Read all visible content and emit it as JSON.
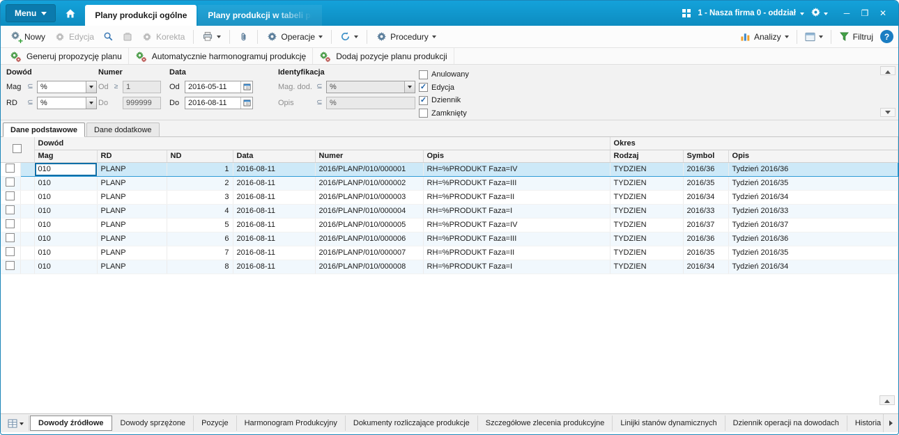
{
  "titlebar": {
    "menu_label": "Menu",
    "company_label": "1 - Nasza firma 0 - oddział",
    "tabs": [
      {
        "label": "Plany produkcji ogólne",
        "active": true
      },
      {
        "label": "Plany produkcji w tabeli prze",
        "active": false
      }
    ]
  },
  "icons": {
    "minimize": "─",
    "maximize": "❐",
    "close": "✕",
    "help": "?"
  },
  "toolbar": {
    "nowy": "Nowy",
    "edycja": "Edycja",
    "korekta": "Korekta",
    "operacje": "Operacje",
    "procedury": "Procedury",
    "analizy": "Analizy",
    "filtruj": "Filtruj"
  },
  "actions": [
    "Generuj propozycję planu",
    "Automatycznie harmonogramuj produkcję",
    "Dodaj pozycje planu produkcji"
  ],
  "filters": {
    "sections": {
      "dowod": "Dowód",
      "numer": "Numer",
      "data": "Data",
      "identyfikacja": "Identyfikacja"
    },
    "mag": {
      "label": "Mag",
      "op": "⊆",
      "value": "%"
    },
    "rd": {
      "label": "RD",
      "op": "⊆",
      "value": "%"
    },
    "numer_od": {
      "label": "Od",
      "op": "≥",
      "value": "1"
    },
    "numer_do": {
      "label": "Do",
      "value": "999999"
    },
    "data_od": {
      "label": "Od",
      "value": "2016-05-11"
    },
    "data_do": {
      "label": "Do",
      "value": "2016-08-11"
    },
    "mag_dod": {
      "label": "Mag. dod.",
      "op": "⊆",
      "value": "%"
    },
    "opis": {
      "label": "Opis",
      "op": "⊆",
      "value": "%"
    },
    "checkboxes": [
      {
        "label": "Anulowany",
        "checked": false
      },
      {
        "label": "Edycja",
        "checked": true
      },
      {
        "label": "Dziennik",
        "checked": true
      },
      {
        "label": "Zamknięty",
        "checked": false
      }
    ]
  },
  "data_tabs": [
    {
      "label": "Dane podstawowe",
      "active": true
    },
    {
      "label": "Dane dodatkowe",
      "active": false
    }
  ],
  "table": {
    "groups": {
      "dowod": "Dowód",
      "okres": "Okres"
    },
    "columns": [
      "Mag",
      "RD",
      "ND",
      "Data",
      "Numer",
      "Opis",
      "Rodzaj",
      "Symbol",
      "Opis"
    ],
    "selected_row": 0,
    "rows": [
      [
        "010",
        "PLANP",
        "1",
        "2016-08-11",
        "2016/PLANP/010/000001",
        "RH=%PRODUKT Faza=IV",
        "TYDZIEN",
        "2016/36",
        "Tydzień 2016/36"
      ],
      [
        "010",
        "PLANP",
        "2",
        "2016-08-11",
        "2016/PLANP/010/000002",
        "RH=%PRODUKT Faza=III",
        "TYDZIEN",
        "2016/35",
        "Tydzień 2016/35"
      ],
      [
        "010",
        "PLANP",
        "3",
        "2016-08-11",
        "2016/PLANP/010/000003",
        "RH=%PRODUKT Faza=II",
        "TYDZIEN",
        "2016/34",
        "Tydzień 2016/34"
      ],
      [
        "010",
        "PLANP",
        "4",
        "2016-08-11",
        "2016/PLANP/010/000004",
        "RH=%PRODUKT Faza=I",
        "TYDZIEN",
        "2016/33",
        "Tydzień 2016/33"
      ],
      [
        "010",
        "PLANP",
        "5",
        "2016-08-11",
        "2016/PLANP/010/000005",
        "RH=%PRODUKT Faza=IV",
        "TYDZIEN",
        "2016/37",
        "Tydzień 2016/37"
      ],
      [
        "010",
        "PLANP",
        "6",
        "2016-08-11",
        "2016/PLANP/010/000006",
        "RH=%PRODUKT Faza=III",
        "TYDZIEN",
        "2016/36",
        "Tydzień 2016/36"
      ],
      [
        "010",
        "PLANP",
        "7",
        "2016-08-11",
        "2016/PLANP/010/000007",
        "RH=%PRODUKT Faza=II",
        "TYDZIEN",
        "2016/35",
        "Tydzień 2016/35"
      ],
      [
        "010",
        "PLANP",
        "8",
        "2016-08-11",
        "2016/PLANP/010/000008",
        "RH=%PRODUKT Faza=I",
        "TYDZIEN",
        "2016/34",
        "Tydzień 2016/34"
      ]
    ]
  },
  "bottom_tabs": {
    "tabs": [
      {
        "label": "Dowody źródłowe",
        "active": true
      },
      {
        "label": "Dowody sprzężone",
        "active": false
      },
      {
        "label": "Pozycje",
        "active": false
      },
      {
        "label": "Harmonogram Produkcyjny",
        "active": false
      },
      {
        "label": "Dokumenty rozliczające produkcje",
        "active": false
      },
      {
        "label": "Szczegółowe zlecenia produkcyjne",
        "active": false
      },
      {
        "label": "Linijki stanów dynamicznych",
        "active": false
      },
      {
        "label": "Dziennik operacji na dowodach",
        "active": false
      },
      {
        "label": "Historia zmian",
        "active": false
      }
    ]
  }
}
